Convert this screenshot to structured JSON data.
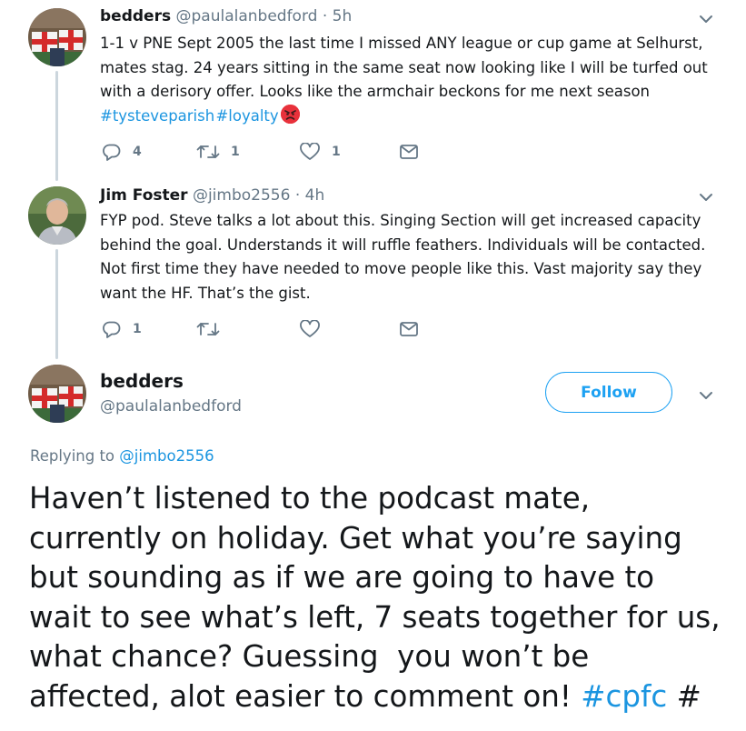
{
  "tweet1": {
    "name": "bedders",
    "handle": "@paulalanbedford",
    "time": "· 5h",
    "line1": "1-1 v PNE Sept 2005 the last time I missed ANY league or cup game at Selhurst,",
    "line2": "mates stag. 24 years sitting in the same seat now looking like I will be turfed out",
    "line3": "with a derisory offer. Looks like the armchair beckons for me next season",
    "hashtag1": "#tysteveparish",
    "hashtag2": "#loyalty",
    "emoji": "angry-face-emoji",
    "reply_count": "4",
    "retweet_count": "1",
    "like_count": "1"
  },
  "tweet2": {
    "name": "Jim Foster",
    "handle": "@jimbo2556",
    "time": "· 4h",
    "line1": "FYP pod. Steve talks a lot about this. Singing Section will get increased capacity",
    "line2": "behind the goal. Understands it will ruffle feathers. Individuals will be contacted.",
    "line3": "Not first time they have needed to move people like this. Vast majority say they",
    "line4": "want the HF. That’s the gist.",
    "reply_count": "1"
  },
  "main_tweet": {
    "name": "bedders",
    "handle": "@paulalanbedford",
    "follow_label": "Follow",
    "replying_prefix": "Replying to",
    "replying_to": "@jimbo2556",
    "line1": "Haven’t listened to the podcast mate,",
    "line2": "currently on holiday. Get what you’re saying",
    "line3": "but sounding as if we are going to have to",
    "line4": "wait to see what’s left, 7 seats together for us,",
    "line5": "what chance? Guessing  you won’t be",
    "line6": "affected, alot easier to comment on!",
    "hashtag": "#cpfc",
    "trailing": "#"
  },
  "colors": {
    "accent": "#1da1f2",
    "hashtag": "#1b95e0",
    "secondary_text": "#657786",
    "thread_line": "#ccd6dd"
  },
  "icons": [
    "reply-icon",
    "retweet-icon",
    "like-icon",
    "message-icon",
    "chevron-down-icon"
  ]
}
